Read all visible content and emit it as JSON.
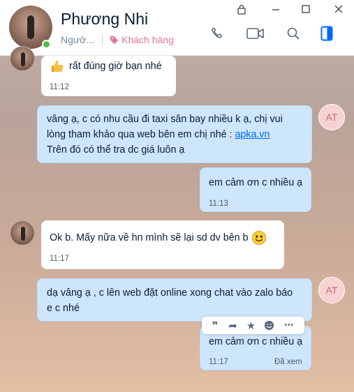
{
  "header": {
    "contact_name": "Phương Nhi",
    "subtitle": "Ngườ...",
    "tag_label": "Khách hàng"
  },
  "messages": [
    {
      "text": "rất đúng giờ bạn nhé",
      "time": "11:12"
    },
    {
      "line1": "vâng ạ, c có nhu cầu đi taxi sân bay nhiều k ạ, chị vui",
      "line2_pre": "lòng tham khảo qua web bên em chị nhé : ",
      "link": "apka.vn",
      "line3": "Trên đó có thể tra dc giá luôn ạ",
      "avatar_initials": "AT"
    },
    {
      "text": "em cảm ơn c nhiều ạ",
      "time": "11:13"
    },
    {
      "text": "Ok b.  Mấy nữa về hn mình sẽ lại sd dv bên b",
      "time": "11:17"
    },
    {
      "line1": "dạ vâng ạ , c lên web đặt online xong chat vào zalo báo",
      "line2": "e c nhé",
      "avatar_initials": "AT"
    },
    {
      "text": "em cảm ơn c nhiều ạ",
      "time": "11:17",
      "status": "Đã xem"
    }
  ],
  "toolbar": {
    "quote_glyph": "❞",
    "forward_glyph": "➦",
    "star_glyph": "★",
    "more_glyph": "•••"
  },
  "colors": {
    "accent": "#0068ff",
    "outgoing_bubble": "#cde6fb",
    "incoming_bubble": "#ffffff",
    "tag": "#e8738b",
    "online": "#4dc247"
  }
}
